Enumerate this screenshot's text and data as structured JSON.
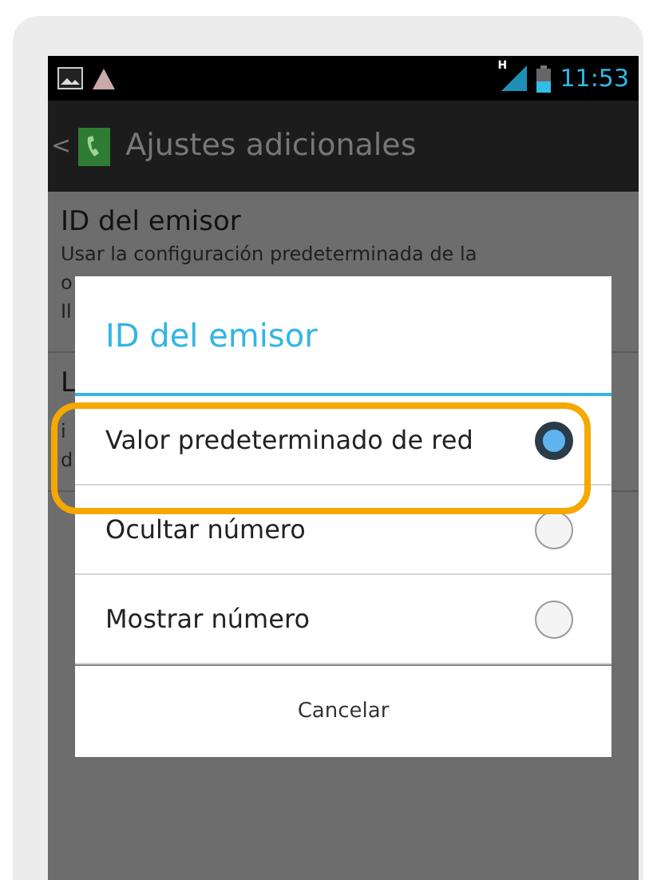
{
  "status_bar": {
    "time": "11:53",
    "network_type": "H"
  },
  "action_bar": {
    "back": "<",
    "title": "Ajustes adicionales"
  },
  "settings": [
    {
      "title": "ID del emisor",
      "summary_lines": [
        "Usar la configuración predeterminada de la",
        "o",
        "Il"
      ]
    },
    {
      "title": "L",
      "summary_lines": [
        "i",
        "d"
      ]
    }
  ],
  "dialog": {
    "title": "ID del emisor",
    "options": [
      {
        "label": "Valor predeterminado de red",
        "selected": true,
        "highlighted": true
      },
      {
        "label": "Ocultar número",
        "selected": false,
        "highlighted": false
      },
      {
        "label": "Mostrar número",
        "selected": false,
        "highlighted": false
      }
    ],
    "cancel": "Cancelar"
  }
}
